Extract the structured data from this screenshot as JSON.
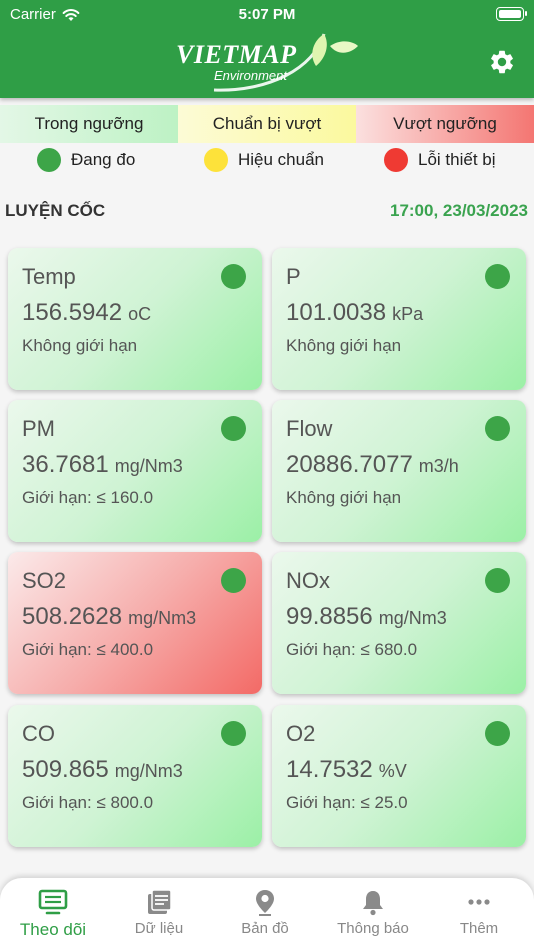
{
  "status_bar": {
    "carrier": "Carrier",
    "time": "5:07 PM"
  },
  "header": {
    "logo_main": "VIETMAP",
    "logo_sub": "Environment",
    "brand_color": "#2f9e46"
  },
  "threshold_legend": [
    {
      "label": "Trong ngưỡng",
      "color": "#bdf2c4"
    },
    {
      "label": "Chuẩn bị vượt",
      "color": "#fbf99e"
    },
    {
      "label": "Vượt ngưỡng",
      "color": "#f47672"
    }
  ],
  "status_legend": [
    {
      "label": "Đang đo",
      "color": "#3da548"
    },
    {
      "label": "Hiệu chuẩn",
      "color": "#fde23a"
    },
    {
      "label": "Lỗi thiết bị",
      "color": "#ef3a33"
    }
  ],
  "station": {
    "name": "LUYỆN CỐC",
    "datetime": "17:00, 23/03/2023"
  },
  "cards": [
    {
      "name": "Temp",
      "value": "156.5942",
      "unit": "oC",
      "limit": "Không giới hạn",
      "state": "normal",
      "status": "Đang đo"
    },
    {
      "name": "P",
      "value": "101.0038",
      "unit": "kPa",
      "limit": "Không giới hạn",
      "state": "normal",
      "status": "Đang đo"
    },
    {
      "name": "PM",
      "value": "36.7681",
      "unit": "mg/Nm3",
      "limit": "Giới hạn: ≤ 160.0",
      "state": "normal",
      "status": "Đang đo"
    },
    {
      "name": "Flow",
      "value": "20886.7077",
      "unit": "m3/h",
      "limit": "Không giới hạn",
      "state": "normal",
      "status": "Đang đo"
    },
    {
      "name": "SO2",
      "value": "508.2628",
      "unit": "mg/Nm3",
      "limit": "Giới hạn: ≤ 400.0",
      "state": "exceeded",
      "status": "Đang đo"
    },
    {
      "name": "NOx",
      "value": "99.8856",
      "unit": "mg/Nm3",
      "limit": "Giới hạn: ≤ 680.0",
      "state": "normal",
      "status": "Đang đo"
    },
    {
      "name": "CO",
      "value": "509.865",
      "unit": "mg/Nm3",
      "limit": "Giới hạn: ≤ 800.0",
      "state": "normal",
      "status": "Đang đo"
    },
    {
      "name": "O2",
      "value": "14.7532",
      "unit": "%V",
      "limit": "Giới hạn: ≤ 25.0",
      "state": "normal",
      "status": "Đang đo"
    }
  ],
  "tabs": [
    {
      "label": "Theo dõi",
      "icon": "monitor-icon",
      "active": true
    },
    {
      "label": "Dữ liệu",
      "icon": "data-icon",
      "active": false
    },
    {
      "label": "Bản đồ",
      "icon": "map-pin-icon",
      "active": false
    },
    {
      "label": "Thông báo",
      "icon": "bell-icon",
      "active": false
    },
    {
      "label": "Thêm",
      "icon": "more-icon",
      "active": false
    }
  ]
}
